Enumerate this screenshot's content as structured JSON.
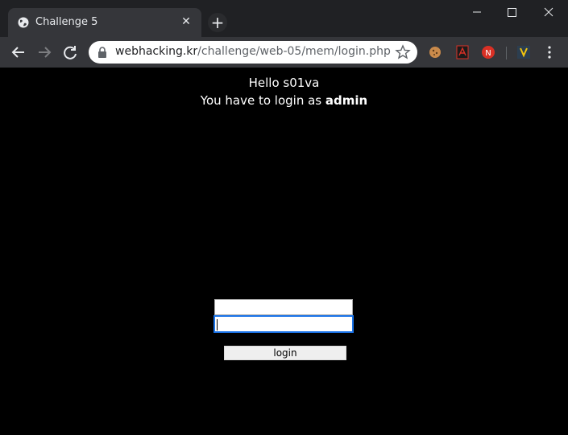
{
  "browser": {
    "tab": {
      "title": "Challenge 5",
      "favicon": "globe-icon"
    },
    "address": {
      "host": "webhacking.kr",
      "path": "/challenge/web-05/mem/login.php"
    },
    "extensions": [
      "cookie-icon",
      "pdf-icon",
      "red-badge-icon",
      "avatar-icon"
    ],
    "accent": "#35363a"
  },
  "page": {
    "hello_text": "Hello s01va",
    "login_prefix": "You have to login as ",
    "login_user": "admin",
    "form": {
      "id_value": "",
      "pw_value": "",
      "button_label": "login"
    }
  }
}
